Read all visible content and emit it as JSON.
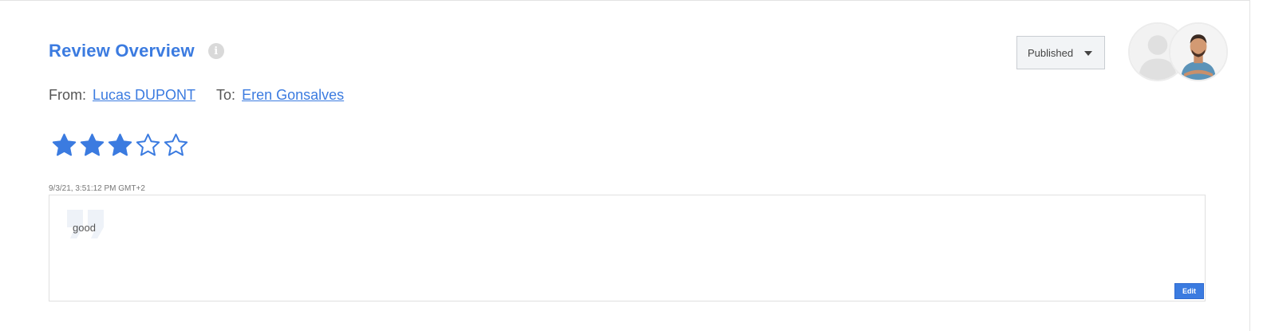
{
  "header": {
    "title": "Review Overview",
    "info_icon": "info-icon"
  },
  "parties": {
    "from_label": "From:",
    "from_name": "Lucas DUPONT",
    "to_label": "To:",
    "to_name": "Eren Gonsalves"
  },
  "rating": {
    "value": 3,
    "max": 5,
    "filled_color": "#3b7be0"
  },
  "review": {
    "timestamp": "9/3/21, 3:51:12 PM GMT+2",
    "comment": "good",
    "edit_label": "Edit",
    "quote_icon": "quote-icon"
  },
  "status": {
    "selected": "Published",
    "icon": "caret-down-icon"
  },
  "avatars": [
    {
      "name": "placeholder-avatar"
    },
    {
      "name": "user-avatar"
    }
  ],
  "colors": {
    "accent": "#3b7be0",
    "text": "#555555"
  }
}
